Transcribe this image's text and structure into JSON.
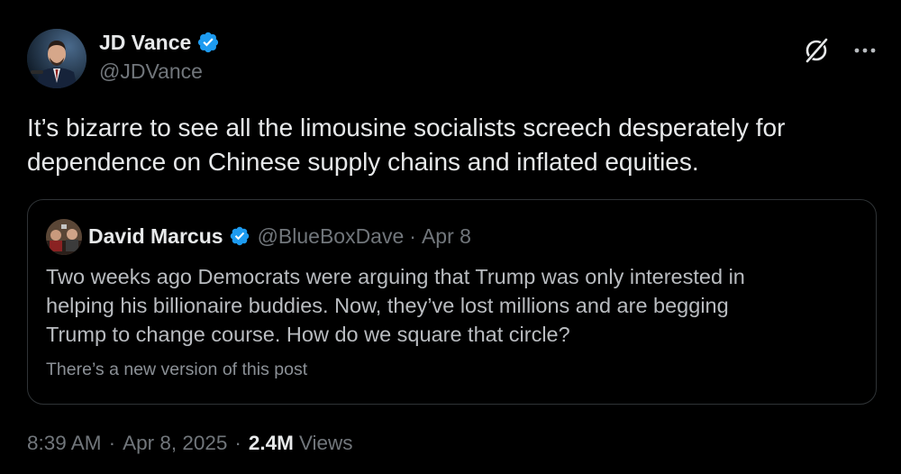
{
  "author": {
    "name": "JD Vance",
    "handle": "@JDVance",
    "verified": true,
    "verified_color": "#1d9bf0"
  },
  "tweet": {
    "text": "It’s bizarre to see all the limousine socialists screech desperately for\ndependence on Chinese supply chains and inflated equities."
  },
  "quoted_post": {
    "author_name": "David Marcus",
    "author_handle": "@BlueBoxDave",
    "separator": "·",
    "date": "Apr 8",
    "verified": true,
    "text": "Two weeks ago Democrats were arguing that Trump was only interested in\nhelping his billionaire buddies. Now, they’ve lost millions and are begging\nTrump to change course. How do we square that circle?",
    "note": "There’s a new version of this post"
  },
  "meta": {
    "time": "8:39 AM",
    "separator": "·",
    "date": "Apr 8, 2025",
    "views_count": "2.4M",
    "views_label": "Views"
  },
  "icons": {
    "grok": "grok-icon",
    "more": "more-icon",
    "verified": "verified-badge-icon"
  },
  "colors": {
    "background": "#000000",
    "text_primary": "#e7e9ea",
    "text_secondary": "#71767b",
    "border": "#2f3336",
    "accent": "#1d9bf0"
  }
}
